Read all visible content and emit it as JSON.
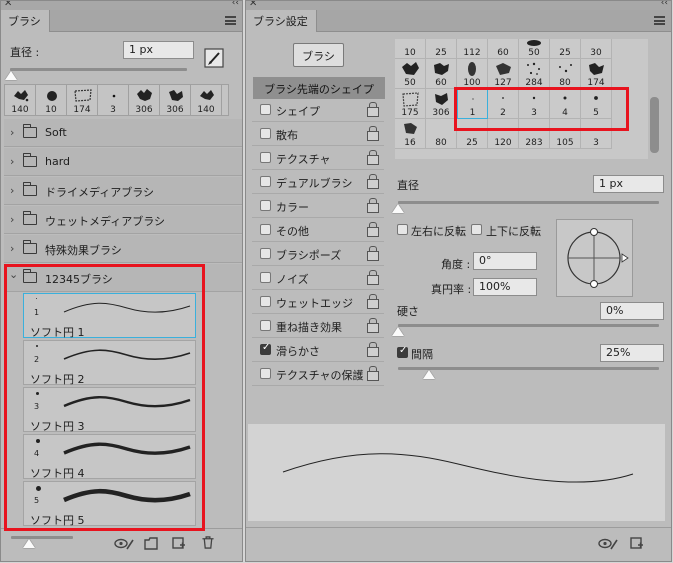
{
  "left_panel": {
    "tab_title": "ブラシ",
    "size_label": "直径 :",
    "size_value": "1 px",
    "presets": [
      "140",
      "10",
      "174",
      "3",
      "306",
      "306",
      "140"
    ],
    "folders": [
      "Soft",
      "hard",
      "ドライメディアブラシ",
      "ウェットメディアブラシ",
      "特殊効果ブラシ"
    ],
    "open_folder": "12345ブラシ",
    "brushes": [
      {
        "size": "1",
        "name": "ソフト円 1"
      },
      {
        "size": "2",
        "name": "ソフト円 2"
      },
      {
        "size": "3",
        "name": "ソフト円 3"
      },
      {
        "size": "4",
        "name": "ソフト円 4"
      },
      {
        "size": "5",
        "name": "ソフト円 5"
      }
    ]
  },
  "right_panel": {
    "tab_title": "ブラシ設定",
    "brush_button": "ブラシ",
    "settings_header": "ブラシ先端のシェイプ",
    "settings": [
      {
        "label": "シェイプ",
        "checked": false
      },
      {
        "label": "散布",
        "checked": false
      },
      {
        "label": "テクスチャ",
        "checked": false
      },
      {
        "label": "デュアルブラシ",
        "checked": false
      },
      {
        "label": "カラー",
        "checked": false
      },
      {
        "label": "その他",
        "checked": false
      },
      {
        "label": "ブラシポーズ",
        "checked": false
      },
      {
        "label": "ノイズ",
        "checked": false
      },
      {
        "label": "ウェットエッジ",
        "checked": false
      },
      {
        "label": "重ね描き効果",
        "checked": false
      },
      {
        "label": "滑らかさ",
        "checked": true
      },
      {
        "label": "テクスチャの保護",
        "checked": false
      }
    ],
    "grid_rows": [
      [
        "10",
        "25",
        "112",
        "60",
        "50",
        "25",
        "30"
      ],
      [
        "50",
        "60",
        "100",
        "127",
        "284",
        "80",
        "174"
      ],
      [
        "175",
        "306",
        "1",
        "2",
        "3",
        "4",
        "5"
      ],
      [
        "16",
        "80",
        "25",
        "120",
        "283",
        "105",
        "3"
      ]
    ],
    "size_label": "直径",
    "size_value": "1 px",
    "flip_x_label": "左右に反転",
    "flip_y_label": "上下に反転",
    "angle_label": "角度 :",
    "angle_value": "0°",
    "roundness_label": "真円率 :",
    "roundness_value": "100%",
    "hardness_label": "硬さ",
    "hardness_value": "0%",
    "spacing_label": "間隔",
    "spacing_value": "25%",
    "spacing_checked": true
  }
}
